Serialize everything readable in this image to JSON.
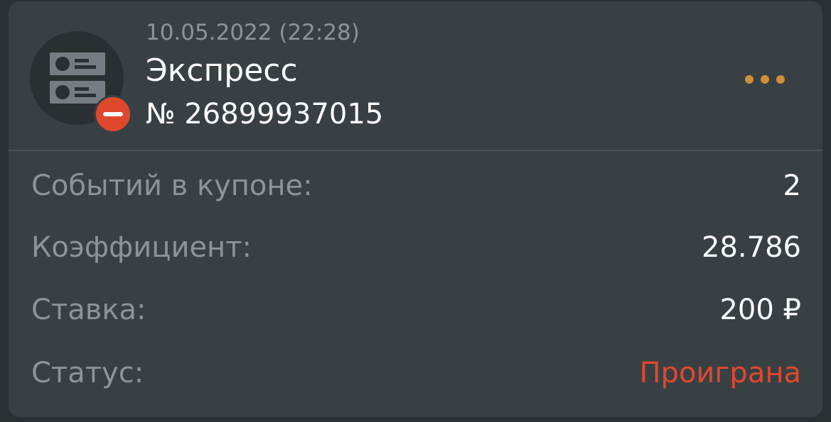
{
  "coupon": {
    "date": "10.05.2022 (22:28)",
    "title": "Экспресс",
    "number": "№ 26899937015",
    "avatar_icon": "coupon-list-icon",
    "status_icon": "minus-circle-icon",
    "more_icon": "more-dots-icon"
  },
  "details": {
    "events_label": "Событий в купоне:",
    "events_value": "2",
    "coef_label": "Коэффициент:",
    "coef_value": "28.786",
    "stake_label": "Ставка:",
    "stake_value": "200 ₽",
    "status_label": "Статус:",
    "status_value": "Проиграна"
  },
  "colors": {
    "card_bg": "#384043",
    "page_bg": "#2b3033",
    "lost_red": "#e0482e",
    "accent_dots": "#d08f3a",
    "muted_text": "#8c9498"
  }
}
